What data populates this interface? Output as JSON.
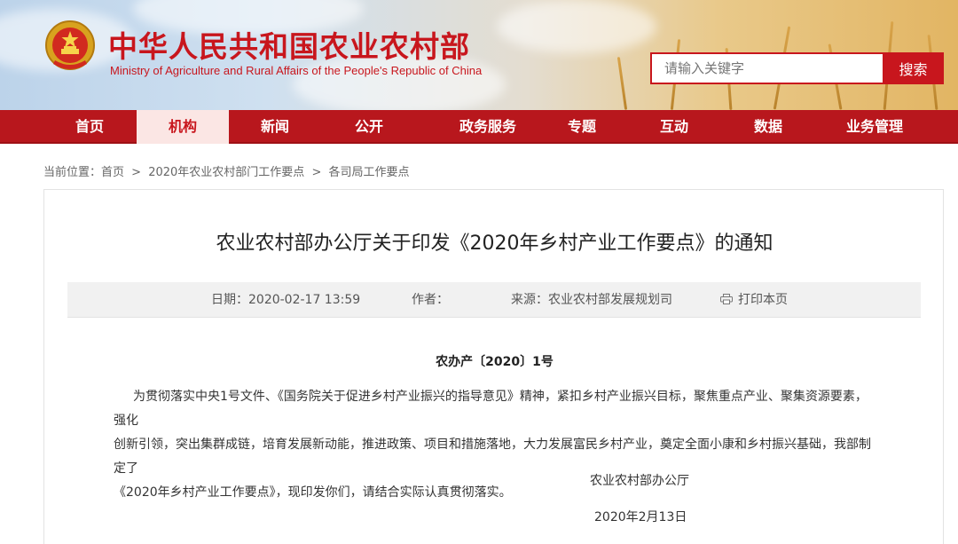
{
  "header": {
    "brand_cn": "中华人民共和国农业农村部",
    "brand_en": "Ministry of Agriculture and Rural Affairs of the People's Republic of China",
    "search_placeholder": "请输入关键字",
    "search_button": "搜索"
  },
  "nav": {
    "items": [
      {
        "label": "首页"
      },
      {
        "label": "机构",
        "active": true
      },
      {
        "label": "新闻"
      },
      {
        "label": "公开"
      },
      {
        "label": "政务服务"
      },
      {
        "label": "专题"
      },
      {
        "label": "互动"
      },
      {
        "label": "数据"
      },
      {
        "label": "业务管理"
      }
    ]
  },
  "breadcrumb": {
    "prefix": "当前位置：",
    "items": [
      "首页",
      "2020年农业农村部门工作要点",
      "各司局工作要点"
    ],
    "separator": ">"
  },
  "article": {
    "title": "农业农村部办公厅关于印发《2020年乡村产业工作要点》的通知",
    "meta": {
      "date_label": "日期：",
      "date_value": "2020-02-17 13:59",
      "author_label": "作者：",
      "author_value": "",
      "source_label": "来源：",
      "source_value": "农业农村部发展规划司",
      "print_label": "打印本页"
    },
    "doc_number": "农办产〔2020〕1号",
    "paragraph_line1": "为贯彻落实中央1号文件、《国务院关于促进乡村产业振兴的指导意见》精神，紧扣乡村产业振兴目标，聚焦重点产业、聚集资源要素，强化",
    "paragraph_line2": "创新引领，突出集群成链，培育发展新动能，推进政策、项目和措施落地，大力发展富民乡村产业，奠定全面小康和乡村振兴基础，我部制定了",
    "paragraph_line3": "《2020年乡村产业工作要点》，现印发你们，请结合实际认真贯彻落实。",
    "signature_org": "农业农村部办公厅",
    "signature_date": "2020年2月13日"
  },
  "colors": {
    "brand_red": "#c8161d",
    "nav_red": "#b8171d",
    "nav_active_bg": "#fbe6e4",
    "meta_bg": "#f1f1f1"
  }
}
